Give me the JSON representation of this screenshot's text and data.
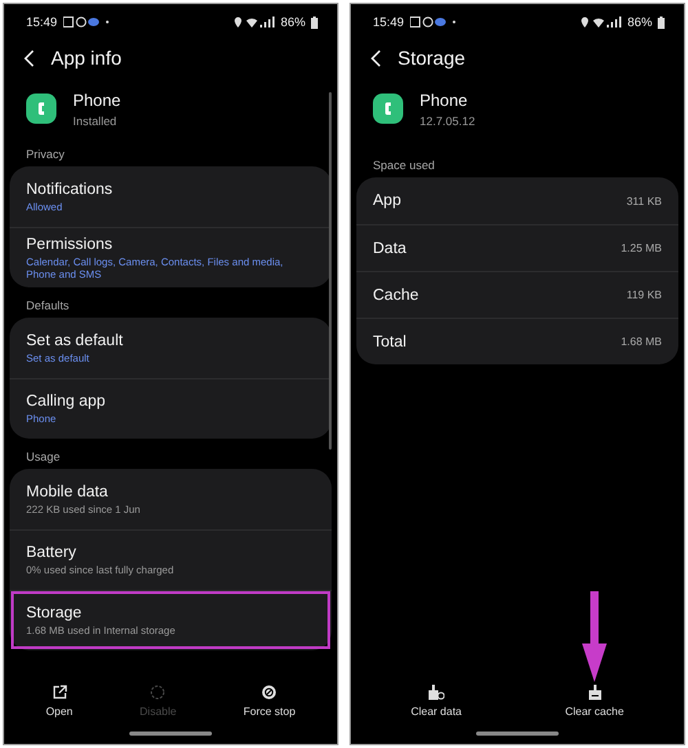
{
  "screens": [
    {
      "kind": "app_info",
      "status": {
        "time": "15:49",
        "battery": "86%"
      },
      "title": "App info",
      "app": {
        "name": "Phone",
        "subtitle": "Installed"
      },
      "sections": [
        {
          "heading": "Privacy",
          "items": [
            {
              "title": "Notifications",
              "subtitle": "Allowed",
              "accent": true,
              "highlighted": false
            },
            {
              "title": "Permissions",
              "subtitle": "Calendar, Call logs, Camera, Contacts, Files and media, Phone and SMS",
              "accent": true,
              "highlighted": false
            }
          ]
        },
        {
          "heading": "Defaults",
          "items": [
            {
              "title": "Set as default",
              "subtitle": "Set as default",
              "accent": true,
              "highlighted": false
            },
            {
              "title": "Calling app",
              "subtitle": "Phone",
              "accent": true,
              "highlighted": false
            }
          ]
        },
        {
          "heading": "Usage",
          "items": [
            {
              "title": "Mobile data",
              "subtitle": "222 KB used since 1 Jun",
              "accent": false,
              "highlighted": false
            },
            {
              "title": "Battery",
              "subtitle": "0% used since last fully charged",
              "accent": false,
              "highlighted": false
            },
            {
              "title": "Storage",
              "subtitle": "1.68 MB used in Internal storage",
              "accent": false,
              "highlighted": true
            }
          ]
        }
      ],
      "actions": [
        {
          "kind": "open",
          "label": "Open",
          "disabled": false,
          "pointed": false
        },
        {
          "kind": "disable",
          "label": "Disable",
          "disabled": true,
          "pointed": false
        },
        {
          "kind": "stop",
          "label": "Force stop",
          "disabled": false,
          "pointed": false
        }
      ]
    },
    {
      "kind": "storage",
      "status": {
        "time": "15:49",
        "battery": "86%"
      },
      "title": "Storage",
      "app": {
        "name": "Phone",
        "subtitle": "12.7.05.12"
      },
      "sections": [
        {
          "heading": "Space used",
          "rows": [
            {
              "label": "App",
              "value": "311 KB"
            },
            {
              "label": "Data",
              "value": "1.25 MB"
            },
            {
              "label": "Cache",
              "value": "119 KB"
            },
            {
              "label": "Total",
              "value": "1.68 MB"
            }
          ]
        }
      ],
      "actions": [
        {
          "kind": "clear_data",
          "label": "Clear data",
          "disabled": false,
          "pointed": false
        },
        {
          "kind": "clear_cache",
          "label": "Clear cache",
          "disabled": false,
          "pointed": true
        }
      ]
    }
  ]
}
